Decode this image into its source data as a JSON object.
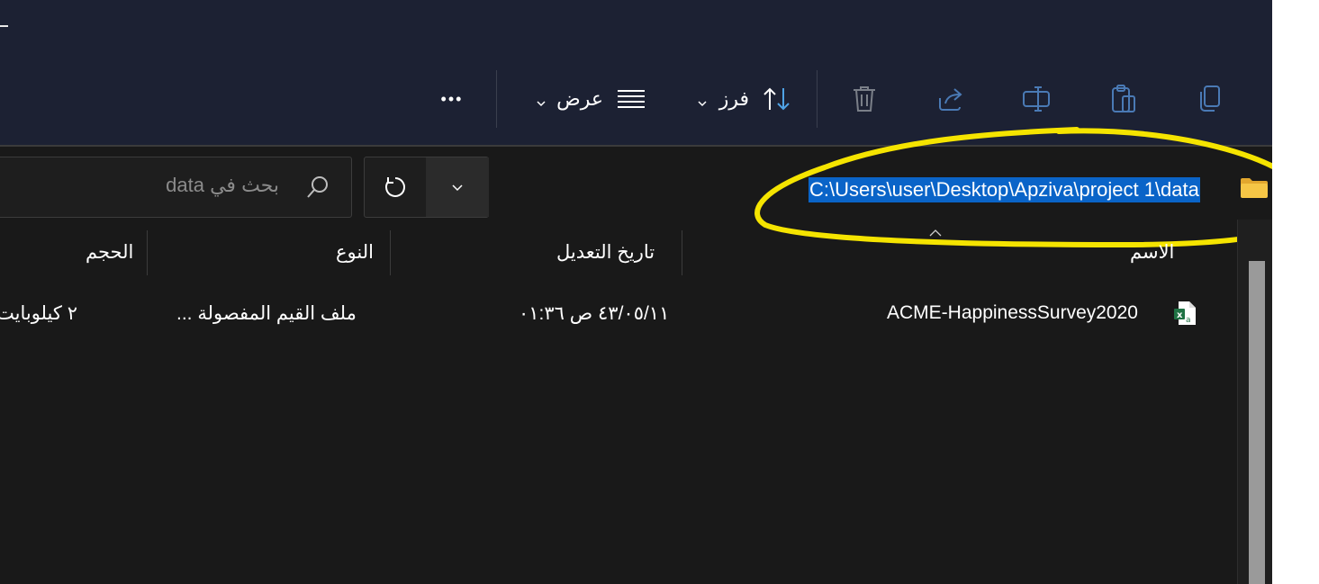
{
  "toolbar": {
    "more_label": "•••",
    "view_label": "عرض",
    "sort_label": "فرز",
    "icons": [
      "copy-icon",
      "paste-icon",
      "rename-icon",
      "share-icon",
      "delete-icon",
      "sort-icon",
      "view-icon",
      "more-icon"
    ]
  },
  "address_bar": {
    "path": "C:\\Users\\user\\Desktop\\Apziva\\project 1\\data"
  },
  "search": {
    "placeholder": "بحث في data"
  },
  "columns": {
    "name": "الاسم",
    "date": "تاريخ التعديل",
    "type": "النوع",
    "size": "الحجم"
  },
  "files": [
    {
      "name": "ACME-HappinessSurvey2020",
      "date": "٤٣/٠٥/١١ ص ٠١:٣٦",
      "type": "ملف القيم المفصولة ...",
      "size": "٢ كيلوبايت"
    }
  ],
  "colors": {
    "titlebar": "#1c2133",
    "content_bg": "#191919",
    "selection": "#0a64c8",
    "annotation": "#f5e400",
    "toolbar_icon": "#4a7ab5"
  }
}
